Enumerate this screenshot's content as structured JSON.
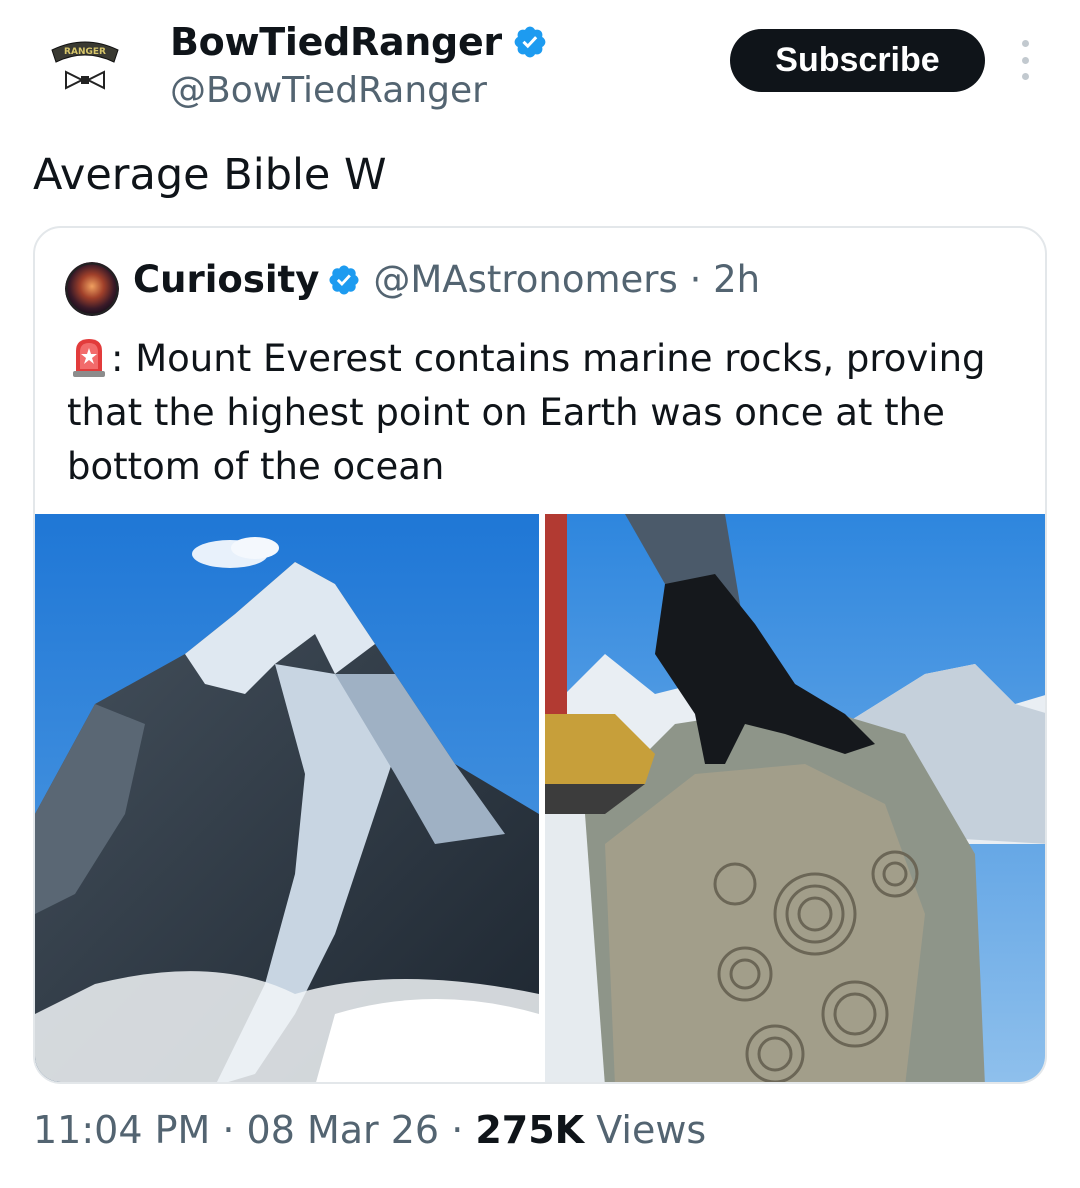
{
  "author": {
    "name": "BowTiedRanger",
    "handle": "@BowTiedRanger",
    "avatar_icon": "ranger-bowtie-logo",
    "avatar_tab_text": "RANGER",
    "verified": true
  },
  "actions": {
    "subscribe_label": "Subscribe",
    "more_icon": "more-vertical-icon"
  },
  "tweet": {
    "text": "Average Bible W"
  },
  "quoted": {
    "name": "Curiosity",
    "handle": "@MAstronomers",
    "separator": "·",
    "time": "2h",
    "emoji_icon": "rotating-light-icon",
    "text": ": Mount Everest contains marine rocks, proving that the highest point on Earth was once at the bottom of the ocean",
    "images": [
      {
        "name": "snowy-mountain-peak-photo"
      },
      {
        "name": "gloved-hand-on-ammonite-fossil-rock-photo"
      }
    ]
  },
  "footer": {
    "time": "11:04 PM",
    "sep1": " · ",
    "date": "08 Mar 26",
    "sep2": " · ",
    "views_count": "275K",
    "views_label": " Views"
  },
  "colors": {
    "verified": "#1d9bf0",
    "text_primary": "#0f1419",
    "text_secondary": "#536471",
    "button_bg": "#0f1419",
    "border": "#e3e7ea"
  }
}
